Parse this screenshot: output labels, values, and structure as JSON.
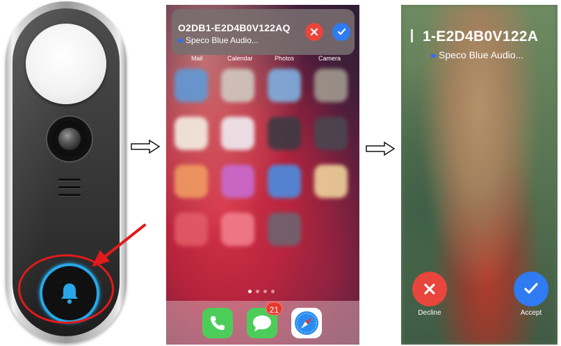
{
  "doorbell": {
    "icons": [
      "bell-icon"
    ],
    "colors": {
      "ring": "#27a6e8",
      "highlight": "#e21a1a"
    }
  },
  "home_screen": {
    "app_labels": [
      "Mail",
      "Calendar",
      "Photos",
      "Camera"
    ],
    "notification": {
      "title": "O2DB1-E2D4B0V122AQ",
      "subtitle": "Speco Blue Audio...",
      "decline_icon": "close-icon",
      "accept_icon": "checkmark-icon"
    },
    "page_dots": 4,
    "dock": {
      "apps": [
        "phone-icon",
        "messages-icon",
        "safari-icon"
      ],
      "messages_badge": "21"
    }
  },
  "call_screen": {
    "title": "1-E2D4B0V122A",
    "subtitle": "Speco Blue Audio...",
    "decline_label": "Decline",
    "accept_label": "Accept",
    "colors": {
      "decline": "#e8453c",
      "accept": "#2f7bf2"
    }
  }
}
